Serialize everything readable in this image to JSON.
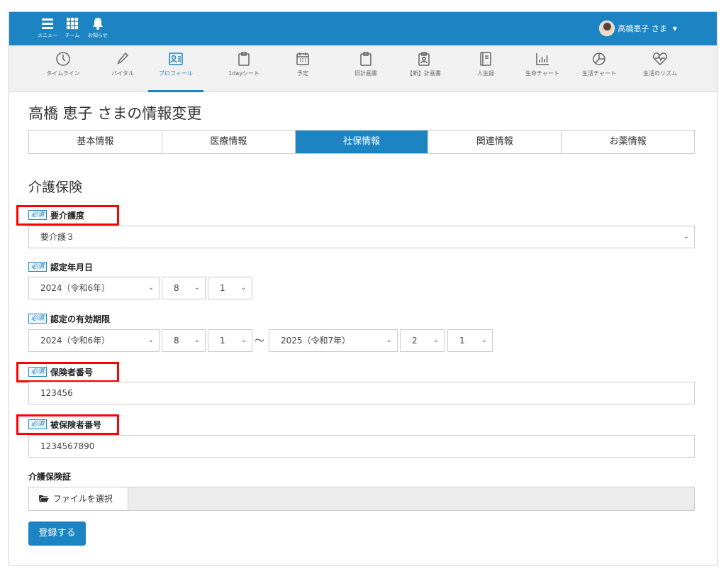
{
  "topbar": {
    "menu_label": "メニュー",
    "team_label": "チーム",
    "notice_label": "お知らせ",
    "user_name": "高橋恵子 さま"
  },
  "nav": [
    {
      "label": "タイムライン",
      "icon": "clock-icon"
    },
    {
      "label": "バイタル",
      "icon": "thermometer-icon"
    },
    {
      "label": "プロフィール",
      "icon": "profile-card-icon"
    },
    {
      "label": "1dayシート",
      "icon": "clipboard-icon"
    },
    {
      "label": "予定",
      "icon": "calendar-icon"
    },
    {
      "label": "旧計画書",
      "icon": "clipboard-icon"
    },
    {
      "label": "【新】計画書",
      "icon": "clipboard-person-icon"
    },
    {
      "label": "人生録",
      "icon": "book-icon"
    },
    {
      "label": "生命チャート",
      "icon": "bar-chart-icon"
    },
    {
      "label": "生活チャート",
      "icon": "pie-chart-icon"
    },
    {
      "label": "生活のリズム",
      "icon": "heart-pulse-icon"
    }
  ],
  "page_title": "高橋 恵子 さまの情報変更",
  "tabs": [
    "基本情報",
    "医療情報",
    "社保情報",
    "関連情報",
    "お薬情報"
  ],
  "section_title": "介護保険",
  "required_badge": "必須",
  "fields": {
    "care_level": {
      "label": "要介護度",
      "value": "要介護３"
    },
    "cert_date": {
      "label": "認定年月日",
      "year": "2024（令和6年）",
      "month": "8",
      "day": "1"
    },
    "valid_period": {
      "label": "認定の有効期限",
      "from_year": "2024（令和6年）",
      "from_month": "8",
      "from_day": "1",
      "separator": "～",
      "to_year": "2025（令和7年）",
      "to_month": "2",
      "to_day": "1"
    },
    "insurer_no": {
      "label": "保険者番号",
      "value": "123456"
    },
    "insured_no": {
      "label": "被保険者番号",
      "value": "1234567890"
    },
    "card": {
      "label": "介護保険証",
      "button": "ファイルを選択"
    }
  },
  "submit_label": "登録する",
  "colors": {
    "primary": "#1d84c4",
    "highlight": "#ff0000"
  }
}
